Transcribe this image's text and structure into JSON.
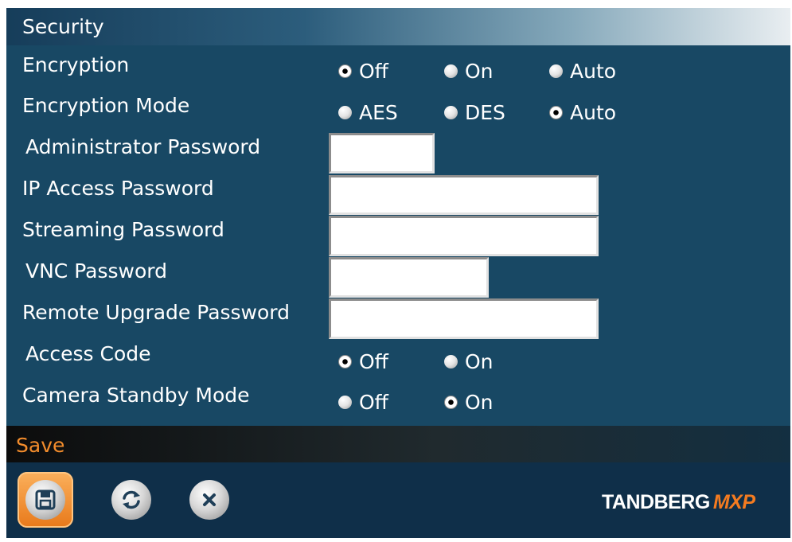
{
  "header": {
    "title": "Security"
  },
  "settings": {
    "encryption": {
      "label": "Encryption",
      "options": [
        "Off",
        "On",
        "Auto"
      ],
      "selected": "Off"
    },
    "encryption_mode": {
      "label": "Encryption Mode",
      "options": [
        "AES",
        "DES",
        "Auto"
      ],
      "selected": "Auto"
    },
    "administrator_password": {
      "label": "Administrator Password",
      "value": ""
    },
    "ip_access_password": {
      "label": "IP Access Password",
      "value": ""
    },
    "streaming_password": {
      "label": "Streaming Password",
      "value": ""
    },
    "vnc_password": {
      "label": "VNC Password",
      "value": ""
    },
    "remote_upgrade_password": {
      "label": "Remote Upgrade Password",
      "value": ""
    },
    "access_code": {
      "label": "Access Code",
      "options": [
        "Off",
        "On"
      ],
      "selected": "Off"
    },
    "camera_standby_mode": {
      "label": "Camera Standby Mode",
      "options": [
        "Off",
        "On"
      ],
      "selected": "On"
    }
  },
  "footer": {
    "action_label": "Save",
    "buttons": {
      "save": "floppy-disk-icon",
      "refresh": "refresh-icon",
      "cancel": "close-icon"
    }
  },
  "brand": {
    "name": "TANDBERG",
    "product": "MXP"
  },
  "colors": {
    "panel": "#184864",
    "accent": "#f28c2c",
    "brand_accent": "#f47b20"
  }
}
